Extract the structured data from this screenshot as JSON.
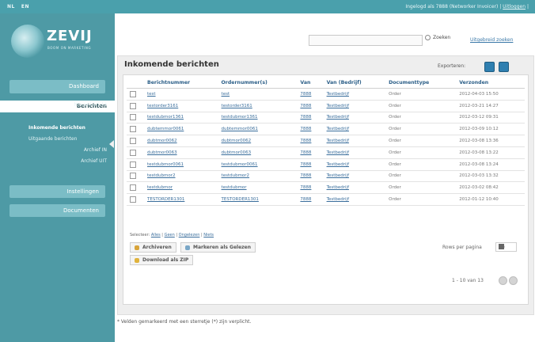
{
  "topbar": {
    "lang_nl": "NL",
    "lang_en": "EN",
    "login_text": "Ingelogd als 7888 (Networker Invoicer) |",
    "logout_label": "Uitloggen",
    "logout_suffix": "|"
  },
  "logo": {
    "name": "ZEVIJ",
    "tagline": "BOOM ON MARKETING"
  },
  "sidebar": {
    "dashboard": "Dashboard",
    "berichten": "Berichten",
    "nieuw_bericht": "Nieuw bericht",
    "inkomende": "Inkomende berichten",
    "uitgaande": "Uitgaande berichten",
    "archief_in": "Archief IN",
    "archief_uit": "Archief UIT",
    "instellingen": "Instellingen",
    "documenten": "Documenten"
  },
  "search": {
    "placeholder": "",
    "button_label": "Zoeken",
    "advanced_link": "Uitgebreid zoeken"
  },
  "panel": {
    "title": "Inkomende berichten",
    "export_label": "Exporteren:"
  },
  "table": {
    "headers": [
      "Berichtnummer",
      "Ordernummer(s)",
      "Van",
      "Van (Bedrijf)",
      "Documenttype",
      "Verzonden"
    ],
    "rows": [
      [
        "test",
        "test",
        "7888",
        "Testbedrijf",
        "Order",
        "2012-04-03 15:50"
      ],
      [
        "testorder3161",
        "testorder3161",
        "7888",
        "Testbedrijf",
        "Order",
        "2012-03-21 14:27"
      ],
      [
        "testdubmor1361",
        "testdubmor1361",
        "7888",
        "Testbedrijf",
        "Order",
        "2012-03-12 09:31"
      ],
      [
        "dubtemmor0061",
        "dubtemmor0061",
        "7888",
        "Testbedrijf",
        "Order",
        "2012-03-09 10:12"
      ],
      [
        "dubtmor0062",
        "dubtmor0062",
        "7888",
        "Testbedrijf",
        "Order",
        "2012-03-08 13:36"
      ],
      [
        "dubtmor0063",
        "dubtmor0063",
        "7888",
        "Testbedrijf",
        "Order",
        "2012-03-08 13:22"
      ],
      [
        "testdubmor0061",
        "testdubmor0061",
        "7888",
        "Testbedrijf",
        "Order",
        "2012-03-08 13:24"
      ],
      [
        "testdubmor2",
        "testdubmor2",
        "7888",
        "Testbedrijf",
        "Order",
        "2012-03-03 13:32"
      ],
      [
        "testdubmor",
        "testdubmor",
        "7888",
        "Testbedrijf",
        "Order",
        "2012-03-02 08:42"
      ],
      [
        "TESTORDER1301",
        "TESTORDER1301",
        "7888",
        "Testbedrijf",
        "Order",
        "2012-01-12 10:40"
      ]
    ]
  },
  "selection": {
    "prefix": "Selecteer:",
    "alles": "Alles",
    "geen": "Geen",
    "ongelezen": "Ongelezen",
    "niets": "Niets"
  },
  "actions": {
    "archive": "Archiveren",
    "mark_read": "Markeren als Gelezen",
    "download_zip": "Download als ZIP"
  },
  "pager": {
    "per_page_label": "Rows per pagina",
    "per_page_value": "10",
    "range_text": "1 - 10 van 13"
  },
  "footnote": "* Velden gemarkeerd met een sterretje (*) zijn verplicht."
}
